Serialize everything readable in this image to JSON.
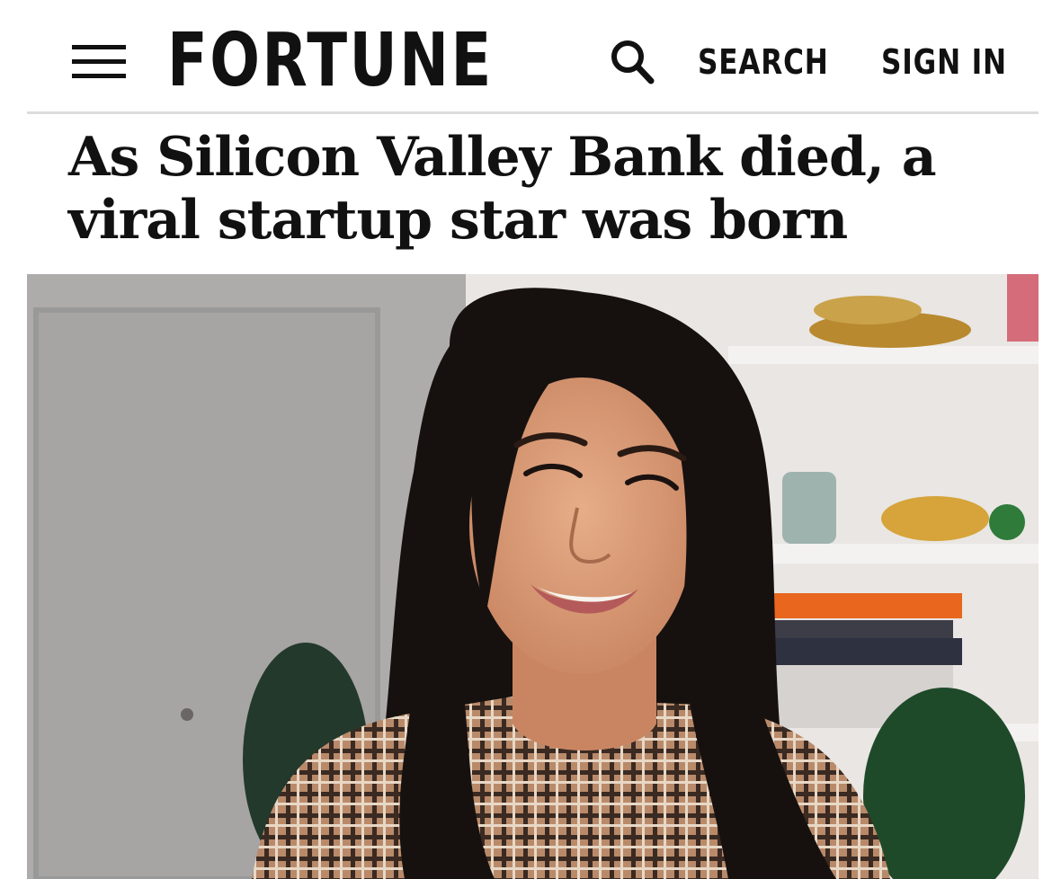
{
  "header": {
    "menu_icon": "hamburger-menu-icon",
    "logo": "FORTUNE",
    "search_icon": "magnifying-glass-icon",
    "search_label": "SEARCH",
    "signin_label": "SIGN IN"
  },
  "article": {
    "headline": "As Silicon Valley Bank died, a viral startup star was born"
  },
  "colors": {
    "text": "#111111",
    "divider": "#dcdcdc",
    "background": "#ffffff"
  }
}
